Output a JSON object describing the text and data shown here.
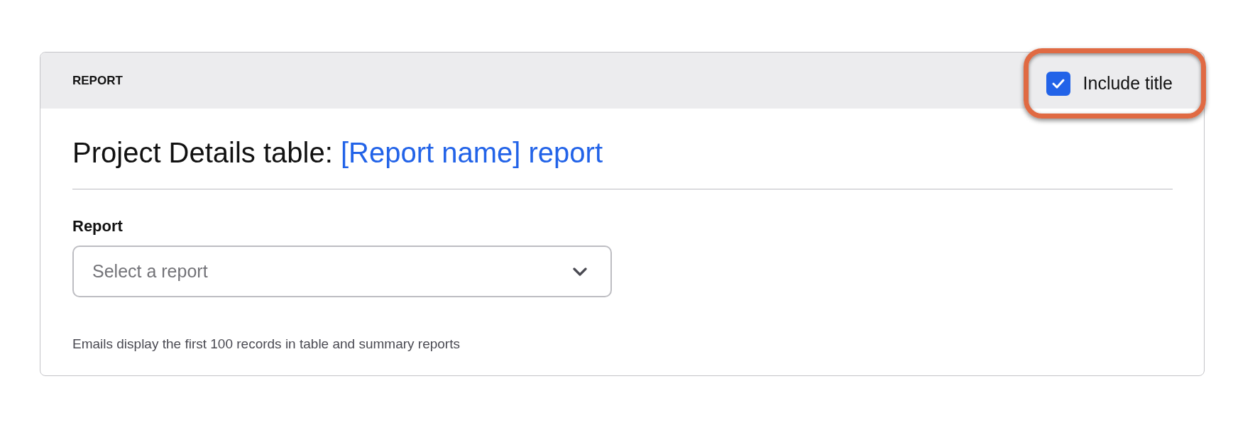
{
  "panel": {
    "header": "REPORT",
    "include_title": {
      "label": "Include title",
      "checked": true,
      "highlighted": true
    },
    "title": {
      "text": "Project Details table:",
      "link": "[Report name] report"
    },
    "report_field": {
      "label": "Report",
      "placeholder": "Select a report"
    },
    "note": "Emails display the first 100 records in table and summary reports"
  }
}
